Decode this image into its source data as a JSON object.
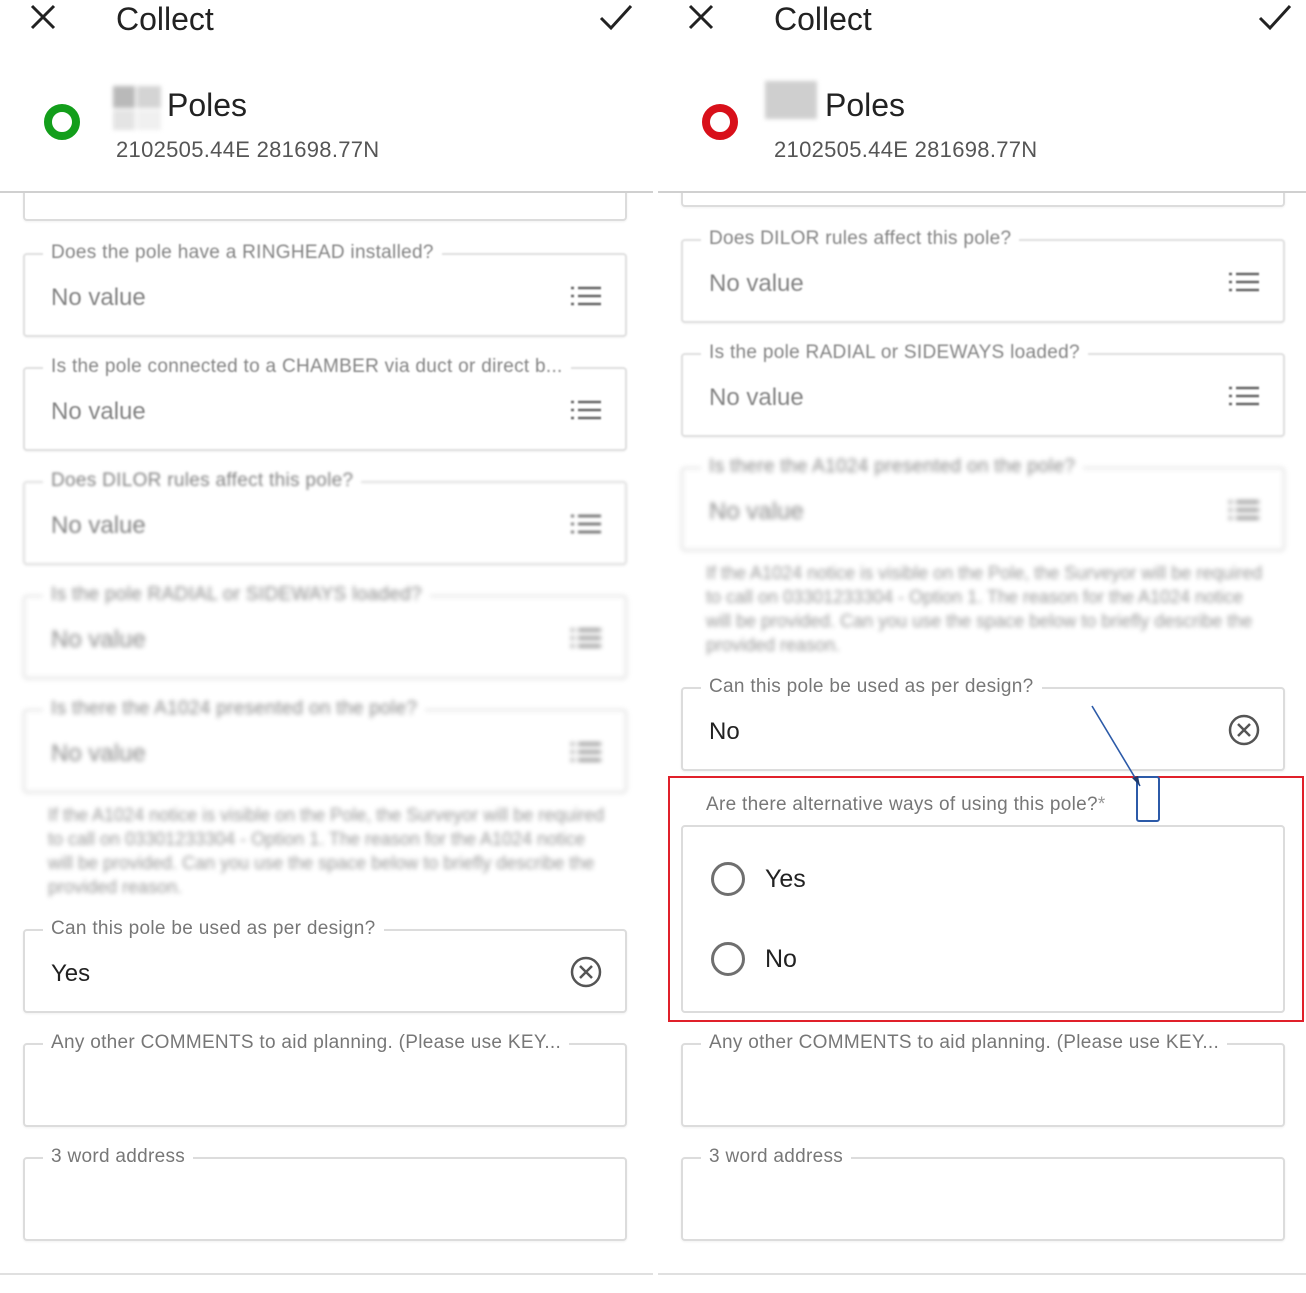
{
  "left": {
    "title": "Collect",
    "layer": "Poles",
    "coords": "2102505.44E 281698.77N",
    "fields": [
      {
        "label": "Does the pole have a RINGHEAD installed?",
        "value": "No value"
      },
      {
        "label": "Is the pole connected to a CHAMBER via duct or direct b...",
        "value": "No value"
      },
      {
        "label": "Does DILOR rules affect this pole?",
        "value": "No value"
      },
      {
        "label": "Is the pole RADIAL or SIDEWAYS loaded?",
        "value": "No value"
      },
      {
        "label": "Is there the A1024 presented on the pole?",
        "value": "No value"
      }
    ],
    "note": "If the A1024 notice is visible on the Pole, the Surveyor will be required to call on 03301233304 - Option 1. The reason for the A1024 notice will be provided. Can you use the space below to briefly describe the provided reason.",
    "design": {
      "label": "Can this pole be used as per design?",
      "value": "Yes"
    },
    "comments": {
      "label": "Any other COMMENTS to aid planning. (Please use KEY..."
    },
    "address": {
      "label": "3 word address"
    }
  },
  "right": {
    "title": "Collect",
    "layer": "Poles",
    "coords": "2102505.44E 281698.77N",
    "fields": [
      {
        "label": "Does DILOR rules affect this pole?",
        "value": "No value"
      },
      {
        "label": "Is the pole RADIAL or SIDEWAYS loaded?",
        "value": "No value"
      },
      {
        "label": "Is there the A1024 presented on the pole?",
        "value": "No value"
      }
    ],
    "note": "If the A1024 notice is visible on the Pole, the Surveyor will be required to call on 03301233304 - Option 1. The reason for the A1024 notice will be provided. Can you use the space below to briefly describe the provided reason.",
    "design": {
      "label": "Can this pole be used as per design?",
      "value": "No"
    },
    "alternative": {
      "label": "Are there alternative ways of using this pole?",
      "required_mark": "*",
      "options": [
        "Yes",
        "No"
      ]
    },
    "comments": {
      "label": "Any other COMMENTS to aid planning. (Please use KEY..."
    },
    "address": {
      "label": "3 word address"
    }
  },
  "colors": {
    "status_ok": "#139e1b",
    "status_error": "#d8101a",
    "highlight": "#e0202a",
    "annotation": "#2c5aa8"
  },
  "icons": [
    "close-icon",
    "check-icon",
    "list-icon",
    "clear-icon",
    "radio-icon"
  ]
}
